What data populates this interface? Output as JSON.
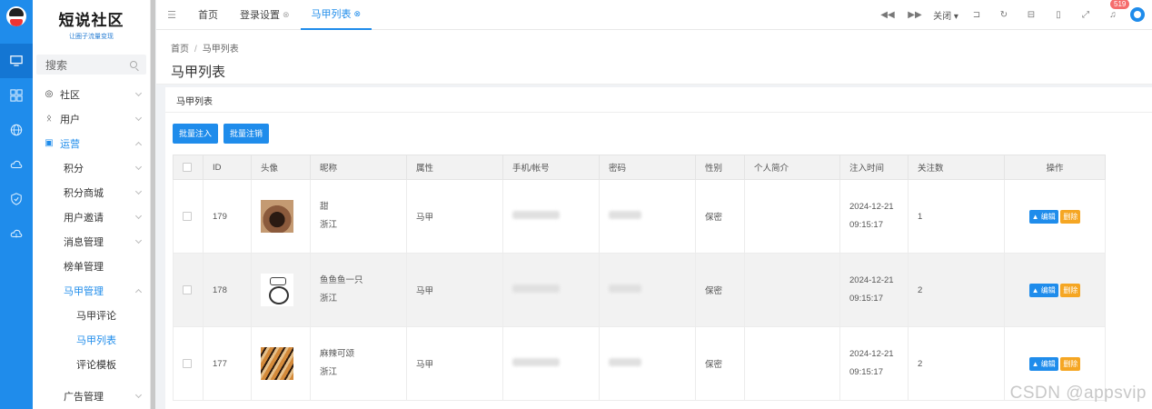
{
  "logo": {
    "title": "短说社区",
    "subtitle": "让圈子流量变现"
  },
  "search": {
    "placeholder": "搜索"
  },
  "menu": [
    {
      "label": "社区",
      "icon": "chat-icon",
      "level": 0,
      "state": "collapsed"
    },
    {
      "label": "用户",
      "icon": "users-icon",
      "level": 0,
      "state": "collapsed"
    },
    {
      "label": "运营",
      "icon": "operate-icon",
      "level": 0,
      "state": "open"
    },
    {
      "label": "积分",
      "level": 1,
      "state": "collapsed"
    },
    {
      "label": "积分商城",
      "level": 1,
      "state": "collapsed"
    },
    {
      "label": "用户邀请",
      "level": 1,
      "state": "collapsed"
    },
    {
      "label": "消息管理",
      "level": 1,
      "state": "collapsed"
    },
    {
      "label": "榜单管理",
      "level": 1,
      "state": "leaf"
    },
    {
      "label": "马甲管理",
      "level": 1,
      "state": "open"
    },
    {
      "label": "马甲评论",
      "level": 2,
      "state": "leaf"
    },
    {
      "label": "马甲列表",
      "level": 2,
      "state": "current"
    },
    {
      "label": "评论模板",
      "level": 2,
      "state": "leaf"
    },
    {
      "label": "广告管理",
      "level": 1,
      "state": "collapsed"
    }
  ],
  "tabs": [
    {
      "label": "首页",
      "closable": false,
      "active": false
    },
    {
      "label": "登录设置",
      "closable": true,
      "active": false
    },
    {
      "label": "马甲列表",
      "closable": true,
      "active": true
    }
  ],
  "topbar": {
    "close_label": "关闭",
    "notification_count": "519"
  },
  "breadcrumb": {
    "home": "首页",
    "sep": "/",
    "current": "马甲列表"
  },
  "page_title": "马甲列表",
  "card_title": "马甲列表",
  "buttons": {
    "batch_inject": "批量注入",
    "batch_cancel": "批量注销"
  },
  "table": {
    "headers": [
      "ID",
      "头像",
      "昵称",
      "属性",
      "手机/帐号",
      "密码",
      "性别",
      "个人简介",
      "注入时间",
      "关注数",
      "操作"
    ],
    "rows": [
      {
        "id": "179",
        "nick": "甜",
        "region": "浙江",
        "attr": "马甲",
        "phone": "···· ····0321",
        "gender": "保密",
        "bio": "",
        "date": "2024-12-21",
        "time": "09:15:17",
        "follows": "1"
      },
      {
        "id": "178",
        "nick": "鱼鱼鱼一只",
        "region": "浙江",
        "attr": "马甲",
        "phone": "···0·····333",
        "gender": "保密",
        "bio": "",
        "date": "2024-12-21",
        "time": "09:15:17",
        "follows": "2"
      },
      {
        "id": "177",
        "nick": "麻辣可颂",
        "region": "浙江",
        "attr": "马甲",
        "phone": "1··· ·······",
        "gender": "保密",
        "bio": "",
        "date": "2024-12-21",
        "time": "09:15:17",
        "follows": "2"
      }
    ],
    "edit_label": "编辑",
    "delete_label": "删除"
  },
  "watermark": "CSDN @appsvip"
}
